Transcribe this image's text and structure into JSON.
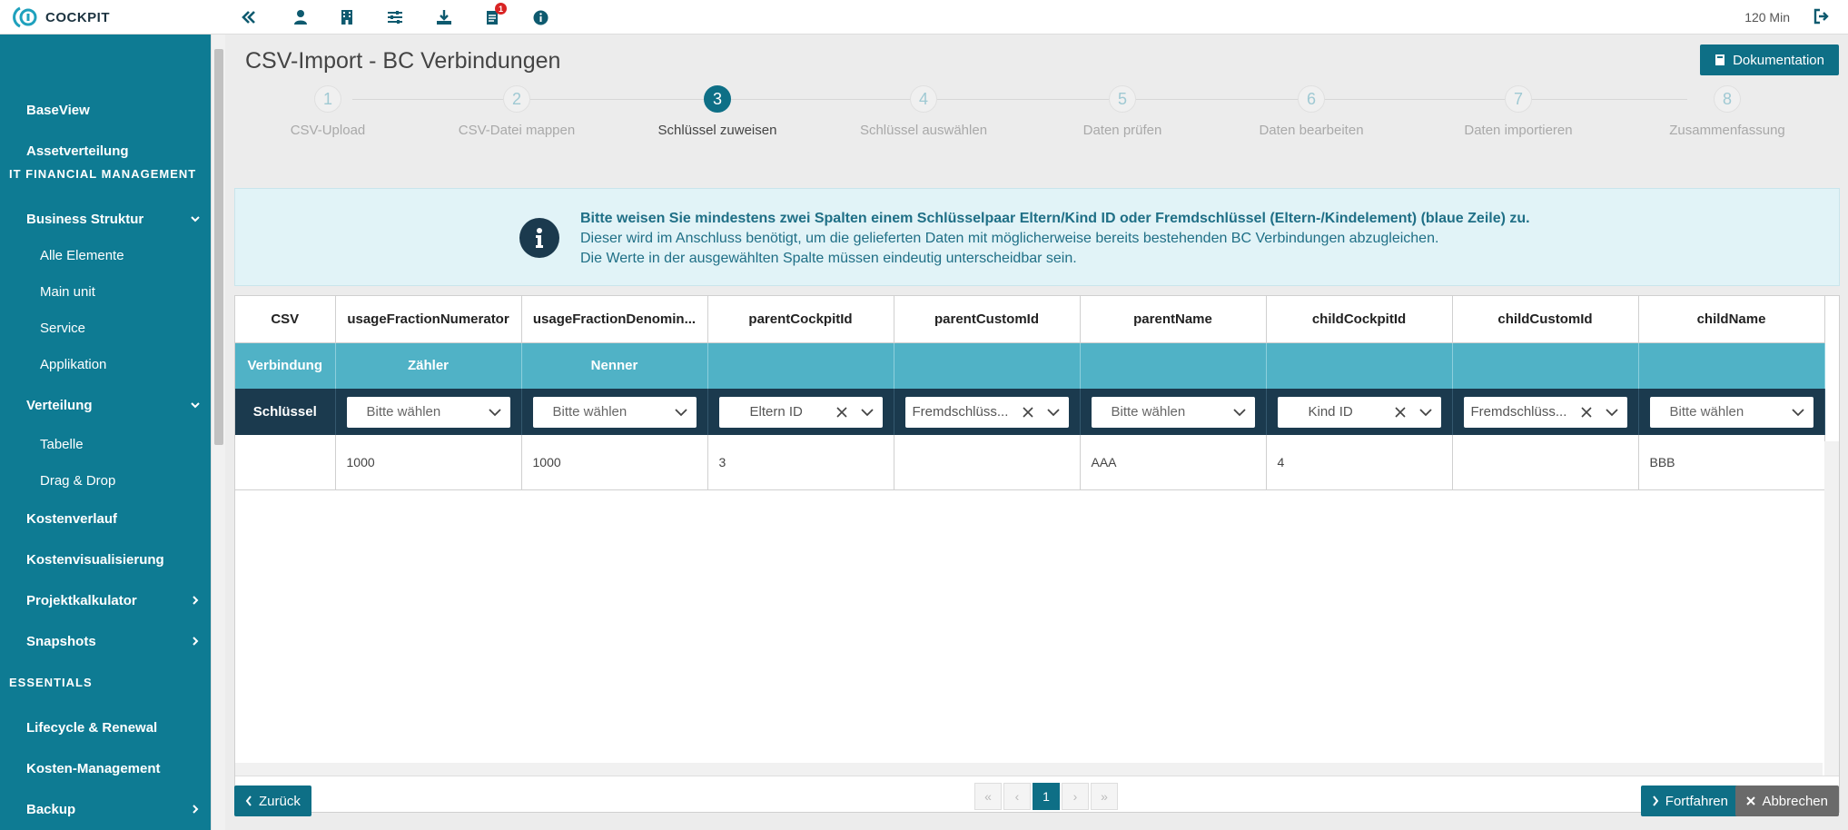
{
  "header": {
    "logo_text": "COCKPIT",
    "timer": "120 Min",
    "notification_count": "1",
    "icons": [
      "collapse-icon",
      "user-icon",
      "building-icon",
      "sliders-icon",
      "download-icon",
      "notes-icon",
      "info-icon",
      "logout-icon"
    ]
  },
  "sidebar": {
    "items": [
      {
        "label": "BaseView"
      },
      {
        "label": "Assetverteilung"
      },
      {
        "section": "IT FINANCIAL MANAGEMENT"
      },
      {
        "label": "Business Struktur"
      },
      {
        "label": "Alle Elemente"
      },
      {
        "label": "Main unit"
      },
      {
        "label": "Service"
      },
      {
        "label": "Applikation"
      },
      {
        "label": "Verteilung"
      },
      {
        "label": "Tabelle"
      },
      {
        "label": "Drag & Drop"
      },
      {
        "label": "Kostenverlauf"
      },
      {
        "label": "Kostenvisualisierung"
      },
      {
        "label": "Projektkalkulator"
      },
      {
        "label": "Snapshots"
      },
      {
        "section": "ESSENTIALS"
      },
      {
        "label": "Lifecycle & Renewal"
      },
      {
        "label": "Kosten-Management"
      },
      {
        "label": "Backup"
      }
    ]
  },
  "page": {
    "title": "CSV-Import - BC Verbindungen",
    "doc_button": "Dokumentation"
  },
  "steps": [
    {
      "num": "1",
      "label": "CSV-Upload"
    },
    {
      "num": "2",
      "label": "CSV-Datei mappen"
    },
    {
      "num": "3",
      "label": "Schlüssel zuweisen"
    },
    {
      "num": "4",
      "label": "Schlüssel auswählen"
    },
    {
      "num": "5",
      "label": "Daten prüfen"
    },
    {
      "num": "6",
      "label": "Daten bearbeiten"
    },
    {
      "num": "7",
      "label": "Daten importieren"
    },
    {
      "num": "8",
      "label": "Zusammenfassung"
    }
  ],
  "active_step": 3,
  "info": {
    "line1": "Bitte weisen Sie mindestens zwei Spalten einem Schlüsselpaar Eltern/Kind ID oder Fremdschlüssel (Eltern-/Kindelement) (blaue Zeile) zu.",
    "line2": "Dieser wird im Anschluss benötigt, um die gelieferten Daten mit möglicherweise bereits bestehenden BC Verbindungen abzugleichen.",
    "line3": "Die Werte in der ausgewählten Spalte müssen eindeutig unterscheidbar sein."
  },
  "table": {
    "row_labels": {
      "csv": "CSV",
      "verbindung": "Verbindung",
      "schluessel": "Schlüssel"
    },
    "columns": [
      "usageFractionNumerator",
      "usageFractionDenomin...",
      "parentCockpitId",
      "parentCustomId",
      "parentName",
      "childCockpitId",
      "childCustomId",
      "childName"
    ],
    "verbindung": [
      "Zähler",
      "Nenner",
      "",
      "",
      "",
      "",
      "",
      ""
    ],
    "schluessel": [
      "Bitte wählen",
      "Bitte wählen",
      "Eltern ID",
      "Fremdschlüss...",
      "Bitte wählen",
      "Kind ID",
      "Fremdschlüss...",
      "Bitte wählen"
    ],
    "rows": [
      [
        "1000",
        "1000",
        "3",
        "",
        "AAA",
        "4",
        "",
        "BBB"
      ]
    ]
  },
  "pager": {
    "current": "1"
  },
  "footer": {
    "back": "Zurück",
    "next": "Fortfahren",
    "cancel": "Abbrechen"
  }
}
